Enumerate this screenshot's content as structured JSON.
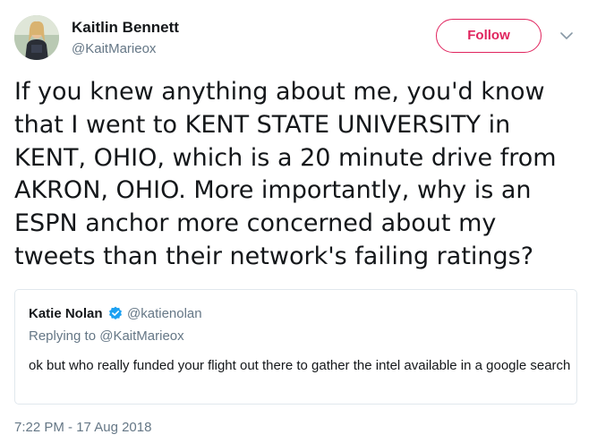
{
  "author": {
    "name": "Kaitlin Bennett",
    "handle": "@KaitMarieox",
    "avatar_icon": "profile-photo"
  },
  "follow_button": {
    "label": "Follow",
    "color": "#e0245e"
  },
  "menu_icon": "chevron-down-icon",
  "tweet": {
    "lines": [
      "If you knew anything about me, you'd know",
      "that I went to KENT STATE UNIVERSITY in",
      "KENT, OHIO, which is a 20 minute drive from",
      "AKRON, OHIO. More importantly, why is an",
      "ESPN anchor more concerned about my",
      "tweets than their network's failing ratings?"
    ]
  },
  "quoted_tweet": {
    "name": "Katie Nolan",
    "verified_icon": "verified-badge-icon",
    "verified_color": "#1da1f2",
    "handle": "@katienolan",
    "replying_to": "Replying to @KaitMarieox",
    "text": "ok but who really funded your flight out there to gather the intel available in a google search"
  },
  "timestamp": "7:22 PM - 17 Aug 2018"
}
